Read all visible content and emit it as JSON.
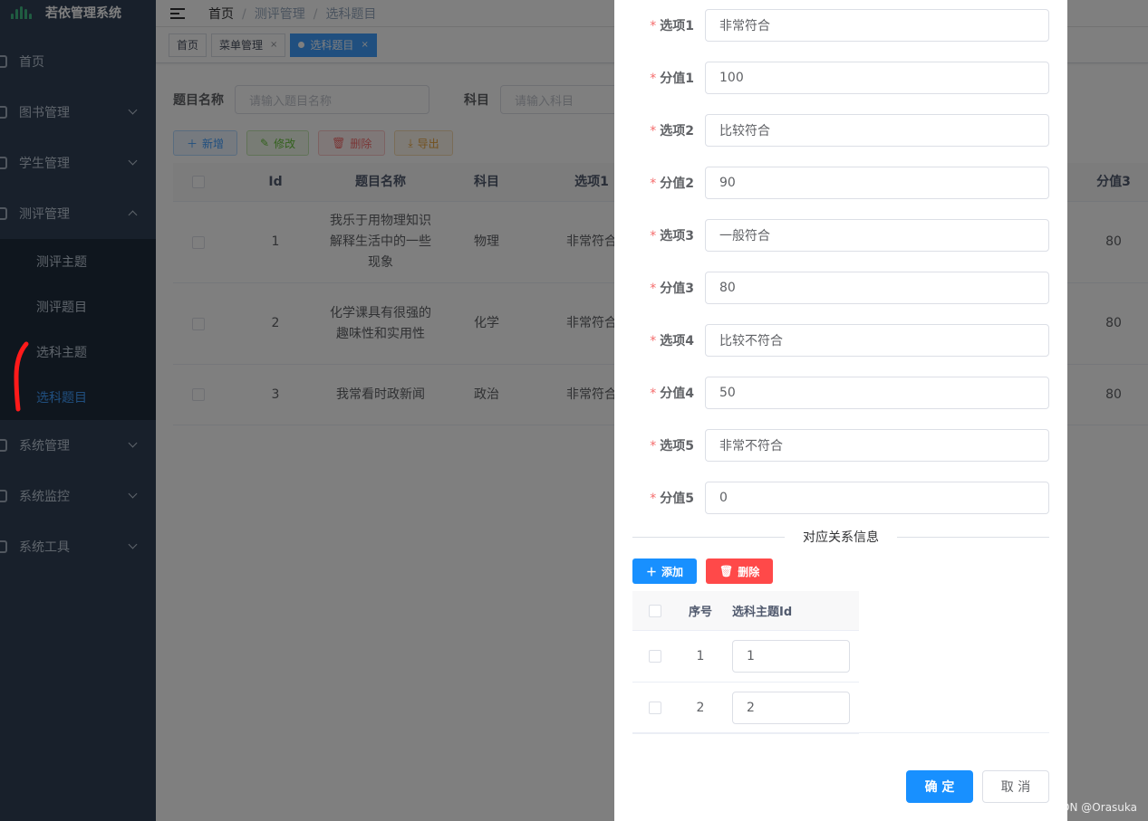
{
  "app": {
    "title": "若依管理系统"
  },
  "sidebar": {
    "items": [
      {
        "label": "首页",
        "icon": "dashboard-icon"
      },
      {
        "label": "图书管理",
        "icon": "book-icon"
      },
      {
        "label": "学生管理",
        "icon": "user-icon"
      },
      {
        "label": "测评管理",
        "icon": "chart-icon",
        "expanded": true
      },
      {
        "label": "系统管理",
        "icon": "settings-icon"
      },
      {
        "label": "系统监控",
        "icon": "monitor-icon"
      },
      {
        "label": "系统工具",
        "icon": "tool-icon"
      }
    ],
    "submenu": [
      "测评主题",
      "测评题目",
      "选科主题",
      "选科题目"
    ],
    "active_submenu": "选科题目"
  },
  "navbar": {
    "breadcrumb": [
      "首页",
      "测评管理",
      "选科题目"
    ]
  },
  "tags": [
    {
      "label": "首页"
    },
    {
      "label": "菜单管理",
      "close": "×"
    },
    {
      "label": "选科题目",
      "close": "×",
      "active": true
    }
  ],
  "search": {
    "name_label": "题目名称",
    "name_placeholder": "请输入题目名称",
    "subject_label": "科目",
    "subject_placeholder": "请输入科目"
  },
  "toolbar": {
    "add": "新增",
    "edit": "修改",
    "delete": "删除",
    "export": "导出"
  },
  "table": {
    "headers": [
      "Id",
      "题目名称",
      "科目",
      "选项1",
      "分值3"
    ],
    "rows": [
      {
        "id": "1",
        "name": "我乐于用物理知识解释生活中的一些现象",
        "subject": "物理",
        "option1": "非常符合",
        "score3": "80"
      },
      {
        "id": "2",
        "name": "化学课具有很强的趣味性和实用性",
        "subject": "化学",
        "option1": "非常符合",
        "score3": "80"
      },
      {
        "id": "3",
        "name": "我常看时政新闻",
        "subject": "政治",
        "option1": "非常符合",
        "score3": "80"
      }
    ]
  },
  "dialog": {
    "required_mark": "*",
    "fields": [
      {
        "label": "选项1",
        "value": "非常符合"
      },
      {
        "label": "分值1",
        "value": "100"
      },
      {
        "label": "选项2",
        "value": "比较符合"
      },
      {
        "label": "分值2",
        "value": "90"
      },
      {
        "label": "选项3",
        "value": "一般符合"
      },
      {
        "label": "分值3",
        "value": "80"
      },
      {
        "label": "选项4",
        "value": "比较不符合"
      },
      {
        "label": "分值4",
        "value": "50"
      },
      {
        "label": "选项5",
        "value": "非常不符合"
      },
      {
        "label": "分值5",
        "value": "0"
      }
    ],
    "divider_text": "对应关系信息",
    "add_button": "添加",
    "delete_button": "删除",
    "sub_table": {
      "headers": [
        "序号",
        "选科主题Id"
      ],
      "rows": [
        {
          "no": "1",
          "topic_id": "1"
        },
        {
          "no": "2",
          "topic_id": "2"
        }
      ]
    },
    "confirm": "确 定",
    "cancel": "取 消"
  },
  "watermark": "CSDN @Orasuka",
  "colors": {
    "primary": "#1890ff",
    "danger": "#ff4949",
    "sidebar_bg": "#304156",
    "submenu_bg": "#1f2d3d",
    "active_menu": "#409eff"
  }
}
